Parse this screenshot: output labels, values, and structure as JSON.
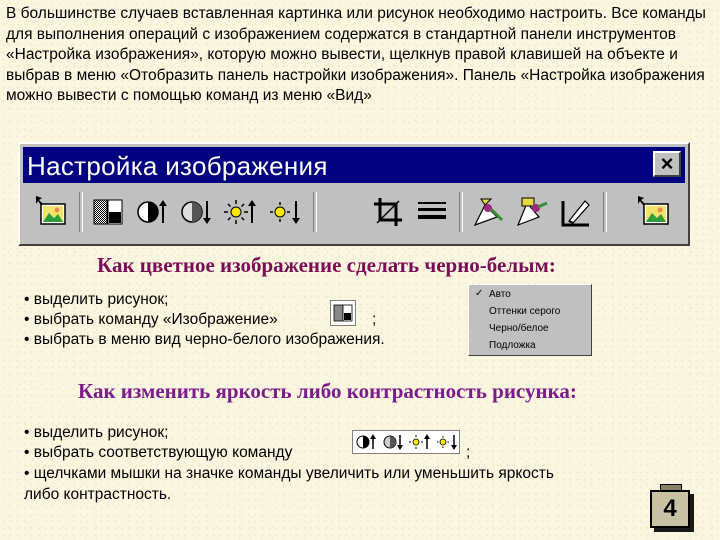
{
  "intro": "В большинстве случаев вставленная картинка или рисунок необходимо настроить. Все команды для выполнения операций с изображением содержатся в стандартной панели инструментов «Настройка изображения», которую можно вывести, щелкнув правой клавишей на объекте и выбрав в меню «Отобразить панель настройки изображения». Панель «Настройка изображения можно вывести с помощью команд из меню «Вид»",
  "window": {
    "title": "Настройка изображения",
    "close_label": "×",
    "tools": [
      "insert-picture-icon",
      "image-color-icon",
      "more-contrast-icon",
      "less-contrast-icon",
      "more-brightness-icon",
      "less-brightness-icon",
      "crop-icon",
      "line-style-icon",
      "text-wrapping-icon",
      "format-picture-icon",
      "set-transparent-color-icon",
      "reset-picture-icon"
    ]
  },
  "section1": {
    "heading": "Как цветное изображение сделать черно-белым:",
    "bullets": [
      "• выделить рисунок;",
      "• выбрать команду «Изображение»",
      "• выбрать в меню вид черно-белого изображения."
    ],
    "semicolon": ";",
    "menu": {
      "checked_mark": "✓",
      "items": [
        "Авто",
        "Оттенки серого",
        "Черно/белое",
        "Подложка"
      ]
    }
  },
  "section2": {
    "heading": "Как изменить яркость либо контрастность рисунка:",
    "bullets": [
      "• выделить рисунок;",
      "• выбрать соответствующую команду",
      "• щелчками мышки на значке команды увеличить или уменьшить яркость",
      "либо контрастность."
    ],
    "semicolon": ";"
  },
  "page_number": "4",
  "colors": {
    "background": "#fbf6df",
    "titlebar": "#000080",
    "heading1": "#7a0c57",
    "heading2": "#7b1b8c"
  }
}
